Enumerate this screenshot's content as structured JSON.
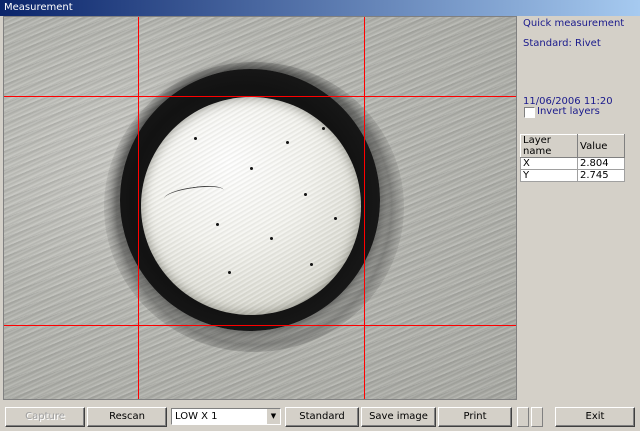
{
  "window": {
    "title": "Measurement"
  },
  "side": {
    "heading": "Quick measurement",
    "standard": "Standard: Rivet",
    "datetime": "11/06/2006 11:20",
    "invert_label": "Invert layers",
    "invert_checked": false
  },
  "layers_table": {
    "headers": [
      "Layer name",
      "Value"
    ],
    "rows": [
      {
        "name": "X",
        "value": "2.804"
      },
      {
        "name": "Y",
        "value": "2.745"
      }
    ]
  },
  "toolbar": {
    "capture_label": "Capture",
    "rescan_label": "Rescan",
    "magnification_value": "LOW X 1",
    "standard_label": "Standard",
    "save_image_label": "Save image",
    "print_label": "Print",
    "exit_label": "Exit"
  },
  "colors": {
    "crosshair": "#ff0000",
    "side_text": "#1a1a8c",
    "title_bar": "#0a246a"
  },
  "icons": {
    "dropdown": "chevron-down-icon",
    "checkbox": "checkbox-icon"
  }
}
